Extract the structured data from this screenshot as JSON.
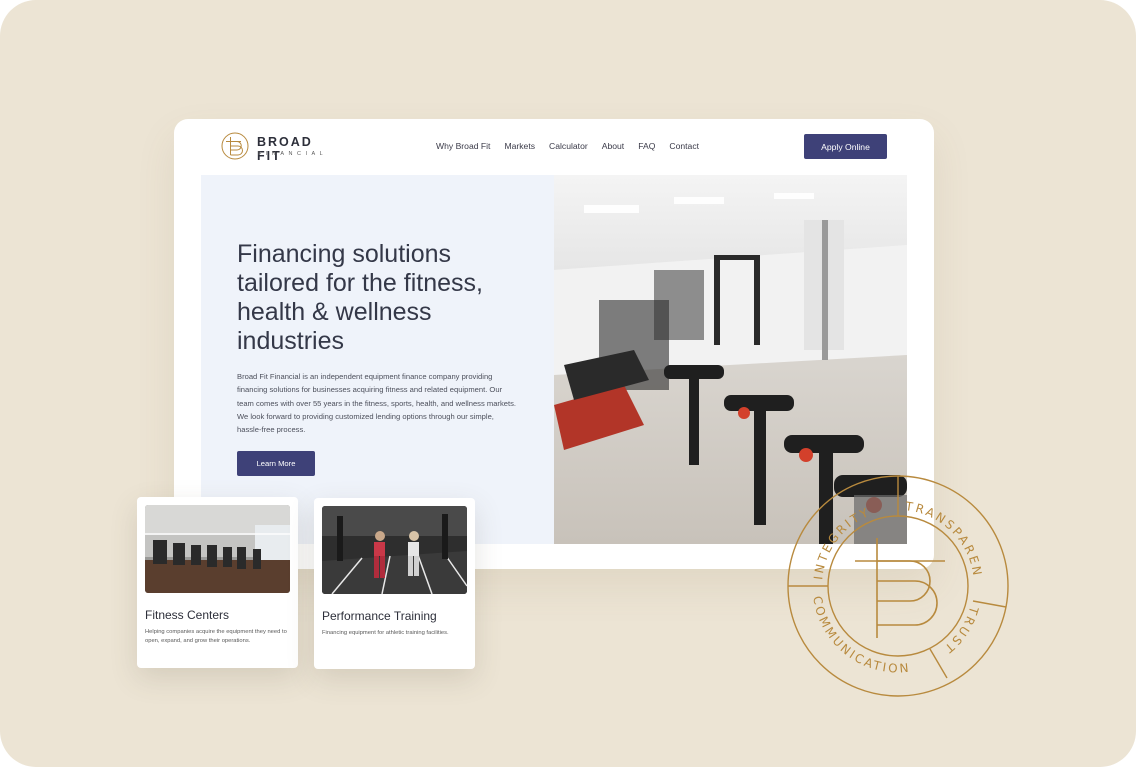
{
  "brand": {
    "name": "BROAD FIT",
    "sub": "FINANCIAL"
  },
  "nav": {
    "links": [
      "Why Broad Fit",
      "Markets",
      "Calculator",
      "About",
      "FAQ",
      "Contact"
    ],
    "cta": "Apply Online"
  },
  "hero": {
    "title": "Financing solutions tailored for the fitness, health & wellness industries",
    "body": "Broad Fit Financial is an independent equipment finance company providing financing solutions for businesses acquiring fitness and related equipment.  Our team comes with over 55 years in the fitness, sports, health, and wellness markets. We look forward to providing customized lending options through our simple, hassle-free process.",
    "button": "Learn More"
  },
  "cards": [
    {
      "title": "Fitness Centers",
      "description": "Helping companies acquire the equipment they need to open, expand, and grow their operations."
    },
    {
      "title": "Performance Training",
      "description": "Financing equipment for athletic training facilities."
    }
  ],
  "seal": {
    "words": [
      "INTEGRITY",
      "TRANSPARENCY",
      "TRUST",
      "COMMUNICATION"
    ]
  },
  "colors": {
    "background": "#ece4d4",
    "accent": "#3e4178",
    "gold": "#b88a3e",
    "hero_panel": "#eff3fa"
  }
}
